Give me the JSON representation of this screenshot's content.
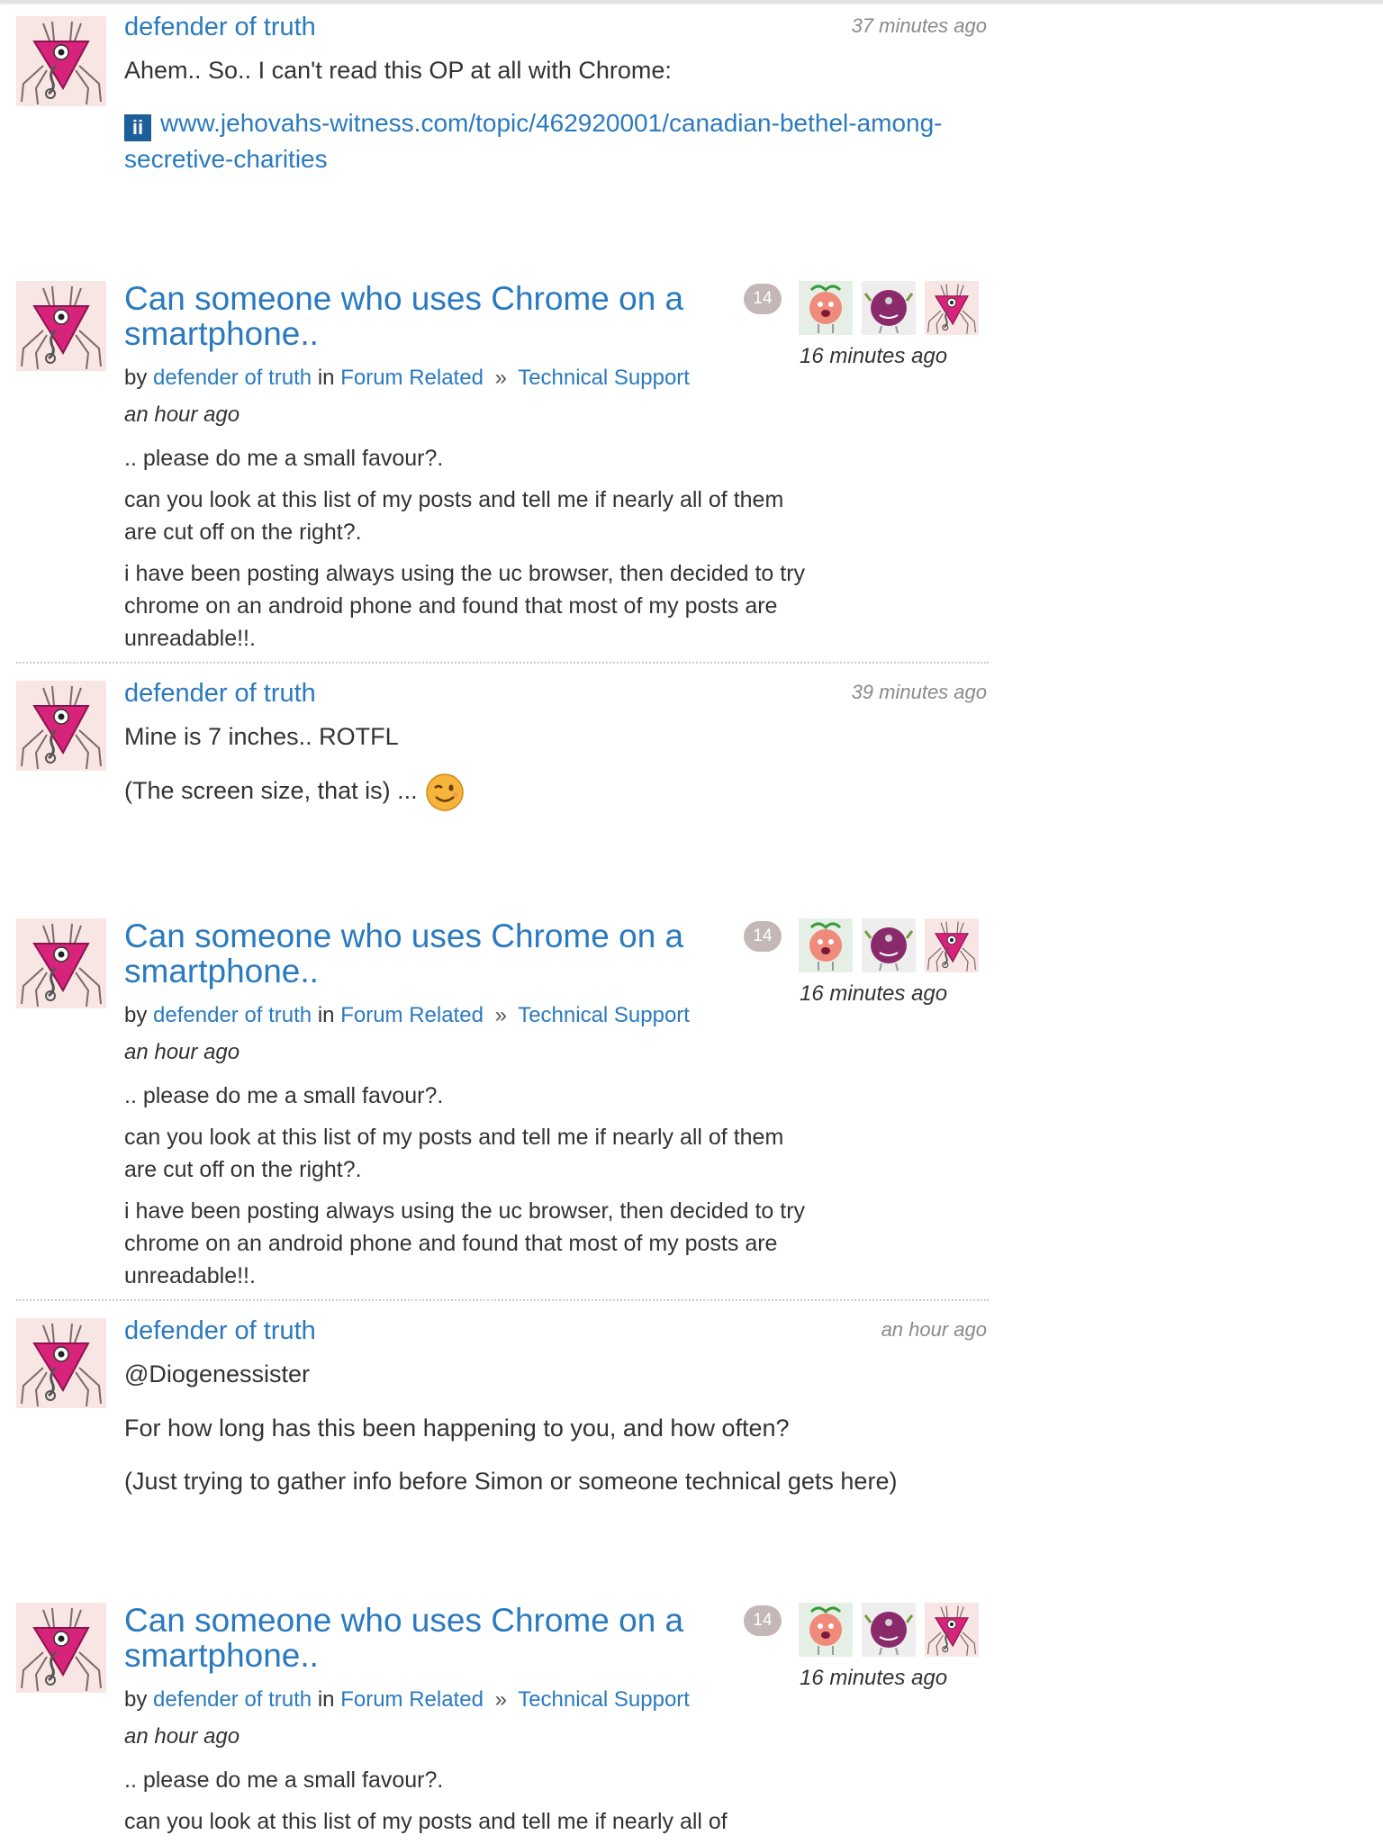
{
  "reply1": {
    "author": "defender of truth",
    "time": "37 minutes ago",
    "text": "Ahem.. So.. I can't read this OP at all with Chrome:",
    "link_favicon": "jw-favicon-icon",
    "link_line1": "www.jehovahs-witness.com/topic/462920001/canadian-bethel-among-",
    "link_line2": "secretive-charities"
  },
  "topic1": {
    "title_line1": "Can someone who uses Chrome on a",
    "title_line2": "smartphone..",
    "by": "by",
    "author": "defender of truth",
    "in": "in",
    "category": "Forum Related",
    "separator": "»",
    "subcategory": "Technical Support",
    "posted": "an hour ago",
    "reply_count": "14",
    "last_activity": "16 minutes ago",
    "paragraphs": [
      ".. please do me a small favour?.",
      "can you look at this list of my posts and tell me if nearly all of them are cut off on the right?.",
      "i have been posting always using the uc browser, then decided to try chrome on an android phone and found that most of my posts are unreadable!!."
    ]
  },
  "reply2": {
    "author": "defender of truth",
    "time": "39 minutes ago",
    "text1": "Mine is 7 inches.. ROTFL",
    "text2": "(The screen size, that is) ...",
    "emoji": "wink-emoji-icon"
  },
  "topic2": {
    "title_line1": "Can someone who uses Chrome on a",
    "title_line2": "smartphone..",
    "by": "by",
    "author": "defender of truth",
    "in": "in",
    "category": "Forum Related",
    "separator": "»",
    "subcategory": "Technical Support",
    "posted": "an hour ago",
    "reply_count": "14",
    "last_activity": "16 minutes ago",
    "paragraphs": [
      ".. please do me a small favour?.",
      "can you look at this list of my posts and tell me if nearly all of them are cut off on the right?.",
      "i have been posting always using the uc browser, then decided to try chrome on an android phone and found that most of my posts are unreadable!!."
    ]
  },
  "reply3": {
    "author": "defender of truth",
    "time": "an hour ago",
    "text1": "@Diogenessister",
    "text2": "For how long has this been happening to you, and how often?",
    "text3": "(Just trying to gather info before Simon or someone technical gets here)"
  },
  "topic3": {
    "title_line1": "Can someone who uses Chrome on a",
    "title_line2": "smartphone..",
    "by": "by",
    "author": "defender of truth",
    "in": "in",
    "category": "Forum Related",
    "separator": "»",
    "subcategory": "Technical Support",
    "posted": "an hour ago",
    "reply_count": "14",
    "last_activity": "16 minutes ago",
    "paragraphs": [
      ".. please do me a small favour?.",
      "can you look at this list of my posts and tell me if nearly all of"
    ]
  },
  "colors": {
    "link": "#2a7abf",
    "text": "#333333",
    "badge": "#c4b7b7",
    "avatar_pink": "#d8237a"
  }
}
